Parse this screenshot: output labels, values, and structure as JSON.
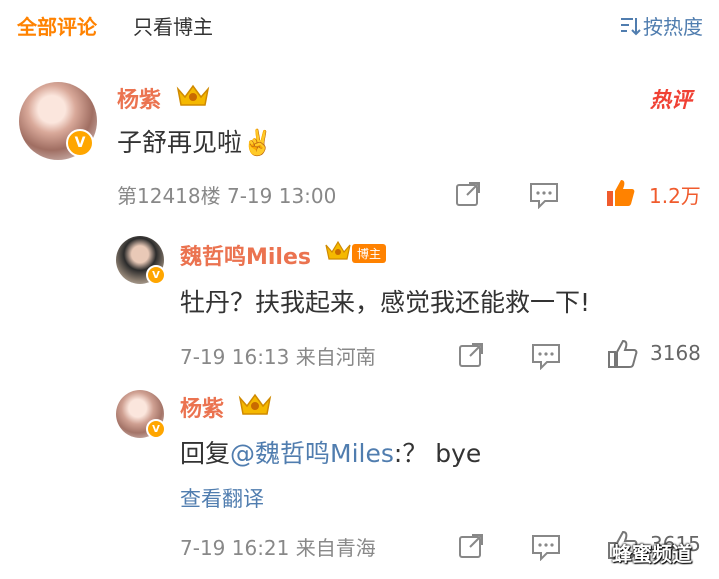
{
  "tabs": {
    "all_comments": "全部评论",
    "only_host": "只看博主"
  },
  "sort": {
    "label": "按热度"
  },
  "hot_badge": "热评",
  "host_badge": "博主",
  "verified_mark": "V",
  "comments": [
    {
      "author": "杨紫",
      "text": "子舒再见啦✌️",
      "floor": "第12418楼",
      "datetime": "7-19 13:00",
      "likes": "1.2万",
      "liked": true
    }
  ],
  "replies": [
    {
      "author": "魏哲鸣Miles",
      "text": "牡丹？扶我起来，感觉我还能救一下!",
      "datetime": "7-19 16:13",
      "location": "来自河南",
      "likes": "3168"
    },
    {
      "author": "杨紫",
      "reply_prefix": "回复",
      "mention": "@魏哲鸣Miles",
      "reply_text": ":？ bye",
      "translate": "查看翻译",
      "datetime": "7-19 16:21",
      "location": "来自青海",
      "likes": "3615"
    }
  ],
  "watermark": "蜂蜜频道",
  "colors": {
    "accent": "#ff8200",
    "name": "#eb7350",
    "link": "#507daf",
    "hot": "#f04134",
    "like_active": "#f05b2d"
  },
  "icons": [
    "sort-icon",
    "share-icon",
    "comment-icon",
    "like-icon",
    "crown-icon",
    "verified-icon"
  ]
}
